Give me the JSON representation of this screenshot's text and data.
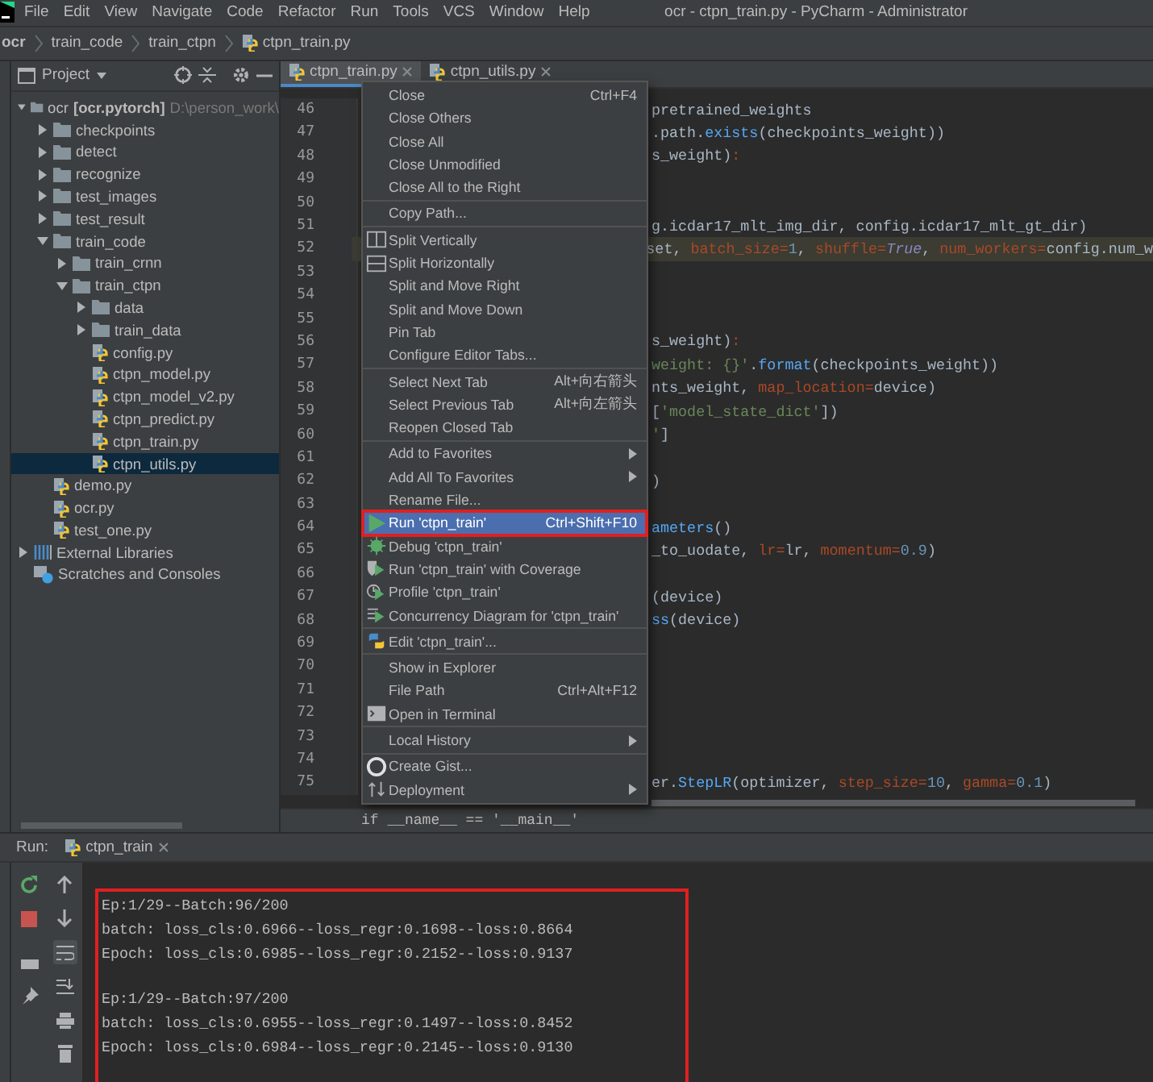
{
  "menu_bar": {
    "items": [
      "File",
      "Edit",
      "View",
      "Navigate",
      "Code",
      "Refactor",
      "Run",
      "Tools",
      "VCS",
      "Window",
      "Help"
    ],
    "title": "ocr - ctpn_train.py - PyCharm - Administrator"
  },
  "breadcrumb": [
    {
      "label": "ocr",
      "kind": "root"
    },
    {
      "label": "train_code",
      "kind": "folder"
    },
    {
      "label": "train_ctpn",
      "kind": "folder"
    },
    {
      "label": "ctpn_train.py",
      "kind": "file"
    }
  ],
  "project": {
    "title": "Project",
    "tree": [
      {
        "label": "ocr",
        "module": "[ocr.pytorch]",
        "path": "D:\\person_work\\",
        "kind": "folder",
        "expanded": true,
        "selected": false,
        "children": [
          {
            "label": "checkpoints",
            "kind": "folder",
            "expanded": false,
            "selected": false
          },
          {
            "label": "detect",
            "kind": "folder",
            "expanded": false,
            "selected": false
          },
          {
            "label": "recognize",
            "kind": "folder",
            "expanded": false,
            "selected": false
          },
          {
            "label": "test_images",
            "kind": "folder",
            "expanded": false,
            "selected": false
          },
          {
            "label": "test_result",
            "kind": "folder",
            "expanded": false,
            "selected": false
          },
          {
            "label": "train_code",
            "kind": "folder",
            "expanded": true,
            "selected": false,
            "children": [
              {
                "label": "train_crnn",
                "kind": "folder",
                "expanded": false,
                "selected": false
              },
              {
                "label": "train_ctpn",
                "kind": "folder",
                "expanded": true,
                "selected": false,
                "children": [
                  {
                    "label": "data",
                    "kind": "folder",
                    "expanded": false,
                    "selected": false
                  },
                  {
                    "label": "train_data",
                    "kind": "folder",
                    "expanded": false,
                    "selected": false
                  },
                  {
                    "label": "config.py",
                    "kind": "file",
                    "selected": false
                  },
                  {
                    "label": "ctpn_model.py",
                    "kind": "file",
                    "selected": false
                  },
                  {
                    "label": "ctpn_model_v2.py",
                    "kind": "file",
                    "selected": false
                  },
                  {
                    "label": "ctpn_predict.py",
                    "kind": "file",
                    "selected": false
                  },
                  {
                    "label": "ctpn_train.py",
                    "kind": "file",
                    "selected": false
                  },
                  {
                    "label": "ctpn_utils.py",
                    "kind": "file",
                    "selected": true
                  }
                ]
              }
            ]
          },
          {
            "label": "demo.py",
            "kind": "file",
            "selected": false
          },
          {
            "label": "ocr.py",
            "kind": "file",
            "selected": false
          },
          {
            "label": "test_one.py",
            "kind": "file",
            "selected": false
          }
        ]
      },
      {
        "label": "External Libraries",
        "kind": "libraries",
        "expanded": false,
        "selected": false
      },
      {
        "label": "Scratches and Consoles",
        "kind": "scratches",
        "selected": false
      }
    ]
  },
  "editor": {
    "tabs": [
      {
        "label": "ctpn_train.py",
        "selected": true
      },
      {
        "label": "ctpn_utils.py",
        "selected": false
      }
    ],
    "lines": [
      {
        "number": "46",
        "current": false,
        "parts": [
          {
            "text": "pretrained_weights",
            "kind": "plain"
          }
        ]
      },
      {
        "number": "47",
        "current": false,
        "parts": [
          {
            "text": ".path.",
            "kind": "plain"
          },
          {
            "text": "exists",
            "kind": "func"
          },
          {
            "text": "(checkpoints_weight))",
            "kind": "plain"
          }
        ]
      },
      {
        "number": "48",
        "current": false,
        "parts": [
          {
            "text": "s_weight)",
            "kind": "plain"
          },
          {
            "text": ":",
            "kind": "param"
          }
        ]
      },
      {
        "number": "49",
        "current": false
      },
      {
        "number": "50",
        "current": false
      },
      {
        "number": "51",
        "current": false,
        "parts": [
          {
            "text": "g.icdar17_mlt_img_dir, config.icdar17_mlt_gt_dir)",
            "kind": "plain"
          }
        ]
      },
      {
        "number": "52",
        "current": true,
        "parts": [
          {
            "text": "set, ",
            "kind": "plain"
          },
          {
            "text": "batch_size=",
            "kind": "param"
          },
          {
            "text": "1",
            "kind": "number"
          },
          {
            "text": ", ",
            "kind": "plain"
          },
          {
            "text": "shuffle=",
            "kind": "param"
          },
          {
            "text": "True",
            "kind": "keyword"
          },
          {
            "text": ", ",
            "kind": "plain"
          },
          {
            "text": "num_workers=",
            "kind": "param"
          },
          {
            "text": "config.num_w",
            "kind": "plain"
          }
        ]
      },
      {
        "number": "53",
        "current": false
      },
      {
        "number": "54",
        "current": false
      },
      {
        "number": "55",
        "current": false
      },
      {
        "number": "56",
        "current": false,
        "parts": [
          {
            "text": "s_weight)",
            "kind": "plain"
          },
          {
            "text": ":",
            "kind": "param"
          }
        ]
      },
      {
        "number": "57",
        "current": false,
        "parts": [
          {
            "text": "weight: {}'",
            "kind": "string"
          },
          {
            "text": ".",
            "kind": "plain"
          },
          {
            "text": "format",
            "kind": "func"
          },
          {
            "text": "(checkpoints_weight))",
            "kind": "plain"
          }
        ]
      },
      {
        "number": "58",
        "current": false,
        "parts": [
          {
            "text": "nts_weight, ",
            "kind": "plain"
          },
          {
            "text": "map_location=",
            "kind": "param"
          },
          {
            "text": "device)",
            "kind": "plain"
          }
        ]
      },
      {
        "number": "59",
        "current": false,
        "parts": [
          {
            "text": "[",
            "kind": "plain"
          },
          {
            "text": "'model_state_dict'",
            "kind": "string"
          },
          {
            "text": "])",
            "kind": "plain"
          }
        ]
      },
      {
        "number": "60",
        "current": false,
        "parts": [
          {
            "text": "'",
            "kind": "string"
          },
          {
            "text": "]",
            "kind": "plain"
          }
        ]
      },
      {
        "number": "61",
        "current": false
      },
      {
        "number": "62",
        "current": false,
        "parts": [
          {
            "text": ")",
            "kind": "plain"
          }
        ]
      },
      {
        "number": "63",
        "current": false
      },
      {
        "number": "64",
        "current": false,
        "parts": [
          {
            "text": "ameters",
            "kind": "func"
          },
          {
            "text": "()",
            "kind": "plain"
          }
        ]
      },
      {
        "number": "65",
        "current": false,
        "parts": [
          {
            "text": "_to_uodate, ",
            "kind": "plain"
          },
          {
            "text": "lr=",
            "kind": "param"
          },
          {
            "text": "lr, ",
            "kind": "plain"
          },
          {
            "text": "momentum=",
            "kind": "param"
          },
          {
            "text": "0.9",
            "kind": "number"
          },
          {
            "text": ")",
            "kind": "plain"
          }
        ]
      },
      {
        "number": "66",
        "current": false
      },
      {
        "number": "67",
        "current": false,
        "parts": [
          {
            "text": "(device)",
            "kind": "plain"
          }
        ]
      },
      {
        "number": "68",
        "current": false,
        "parts": [
          {
            "text": "ss",
            "kind": "func"
          },
          {
            "text": "(device)",
            "kind": "plain"
          }
        ]
      },
      {
        "number": "69",
        "current": false
      },
      {
        "number": "70",
        "current": false
      },
      {
        "number": "71",
        "current": false
      },
      {
        "number": "72",
        "current": false
      },
      {
        "number": "73",
        "current": false
      },
      {
        "number": "74",
        "current": false
      },
      {
        "number": "75",
        "current": false,
        "parts": [
          {
            "text": "er.",
            "kind": "plain"
          },
          {
            "text": "StepLR",
            "kind": "func"
          },
          {
            "text": "(optimizer, ",
            "kind": "plain"
          },
          {
            "text": "step_size=",
            "kind": "param"
          },
          {
            "text": "10",
            "kind": "number"
          },
          {
            "text": ", ",
            "kind": "plain"
          },
          {
            "text": "gamma=",
            "kind": "param"
          },
          {
            "text": "0.1",
            "kind": "number"
          },
          {
            "text": ")",
            "kind": "plain"
          }
        ]
      }
    ],
    "footer": "if __name__ == '__main__'"
  },
  "context_menu": [
    {
      "kind": "item",
      "label": "Close",
      "shortcut": "Ctrl+F4",
      "selected": false,
      "annotated": false
    },
    {
      "kind": "item",
      "label": "Close Others",
      "selected": false,
      "annotated": false
    },
    {
      "kind": "item",
      "label": "Close All",
      "selected": false,
      "annotated": false
    },
    {
      "kind": "item",
      "label": "Close Unmodified",
      "selected": false,
      "annotated": false
    },
    {
      "kind": "item",
      "label": "Close All to the Right",
      "selected": false,
      "annotated": false
    },
    {
      "kind": "separator"
    },
    {
      "kind": "item",
      "label": "Copy Path...",
      "selected": false,
      "annotated": false
    },
    {
      "kind": "separator"
    },
    {
      "kind": "item",
      "label": "Split Vertically",
      "selected": false,
      "annotated": false
    },
    {
      "kind": "item",
      "label": "Split Horizontally",
      "selected": false,
      "annotated": false
    },
    {
      "kind": "item",
      "label": "Split and Move Right",
      "selected": false,
      "annotated": false
    },
    {
      "kind": "item",
      "label": "Split and Move Down",
      "selected": false,
      "annotated": false
    },
    {
      "kind": "item",
      "label": "Pin Tab",
      "selected": false,
      "annotated": false
    },
    {
      "kind": "item",
      "label": "Configure Editor Tabs...",
      "selected": false,
      "annotated": false
    },
    {
      "kind": "separator"
    },
    {
      "kind": "item",
      "label": "Select Next Tab",
      "shortcut": "Alt+向右箭头",
      "selected": false,
      "annotated": false
    },
    {
      "kind": "item",
      "label": "Select Previous Tab",
      "shortcut": "Alt+向左箭头",
      "selected": false,
      "annotated": false
    },
    {
      "kind": "item",
      "label": "Reopen Closed Tab",
      "selected": false,
      "annotated": false
    },
    {
      "kind": "separator"
    },
    {
      "kind": "item",
      "label": "Add to Favorites",
      "submenu": true,
      "selected": false,
      "annotated": false
    },
    {
      "kind": "item",
      "label": "Add All To Favorites",
      "submenu": true,
      "selected": false,
      "annotated": false
    },
    {
      "kind": "item",
      "label": "Rename File...",
      "selected": false,
      "annotated": false
    },
    {
      "kind": "item",
      "label": "Run 'ctpn_train'",
      "shortcut": "Ctrl+Shift+F10",
      "selected": true,
      "annotated": true
    },
    {
      "kind": "item",
      "label": "Debug 'ctpn_train'",
      "selected": false,
      "annotated": false
    },
    {
      "kind": "item",
      "label": "Run 'ctpn_train' with Coverage",
      "selected": false,
      "annotated": false
    },
    {
      "kind": "item",
      "label": "Profile 'ctpn_train'",
      "selected": false,
      "annotated": false
    },
    {
      "kind": "item",
      "label": "Concurrency Diagram for 'ctpn_train'",
      "selected": false,
      "annotated": false
    },
    {
      "kind": "separator"
    },
    {
      "kind": "item",
      "label": "Edit 'ctpn_train'...",
      "selected": false,
      "annotated": false
    },
    {
      "kind": "separator"
    },
    {
      "kind": "item",
      "label": "Show in Explorer",
      "selected": false,
      "annotated": false
    },
    {
      "kind": "item",
      "label": "File Path",
      "shortcut": "Ctrl+Alt+F12",
      "selected": false,
      "annotated": false
    },
    {
      "kind": "item",
      "label": "Open in Terminal",
      "selected": false,
      "annotated": false
    },
    {
      "kind": "separator"
    },
    {
      "kind": "item",
      "label": "Local History",
      "submenu": true,
      "selected": false,
      "annotated": false
    },
    {
      "kind": "separator"
    },
    {
      "kind": "item",
      "label": "Create Gist...",
      "selected": false,
      "annotated": false
    },
    {
      "kind": "item",
      "label": "Deployment",
      "submenu": true,
      "selected": false,
      "annotated": false
    }
  ],
  "run_panel": {
    "label": "Run:",
    "tab": "ctpn_train",
    "console": {
      "annotated": true,
      "blocks": [
        [
          "Ep:1/29--Batch:96/200",
          "batch: loss_cls:0.6966--loss_regr:0.1698--loss:0.8664",
          "Epoch: loss_cls:0.6985--loss_regr:0.2152--loss:0.9137"
        ],
        [
          "Ep:1/29--Batch:97/200",
          "batch: loss_cls:0.6955--loss_regr:0.1497--loss:0.8452",
          "Epoch: loss_cls:0.6984--loss_regr:0.2145--loss:0.9130"
        ]
      ]
    }
  }
}
